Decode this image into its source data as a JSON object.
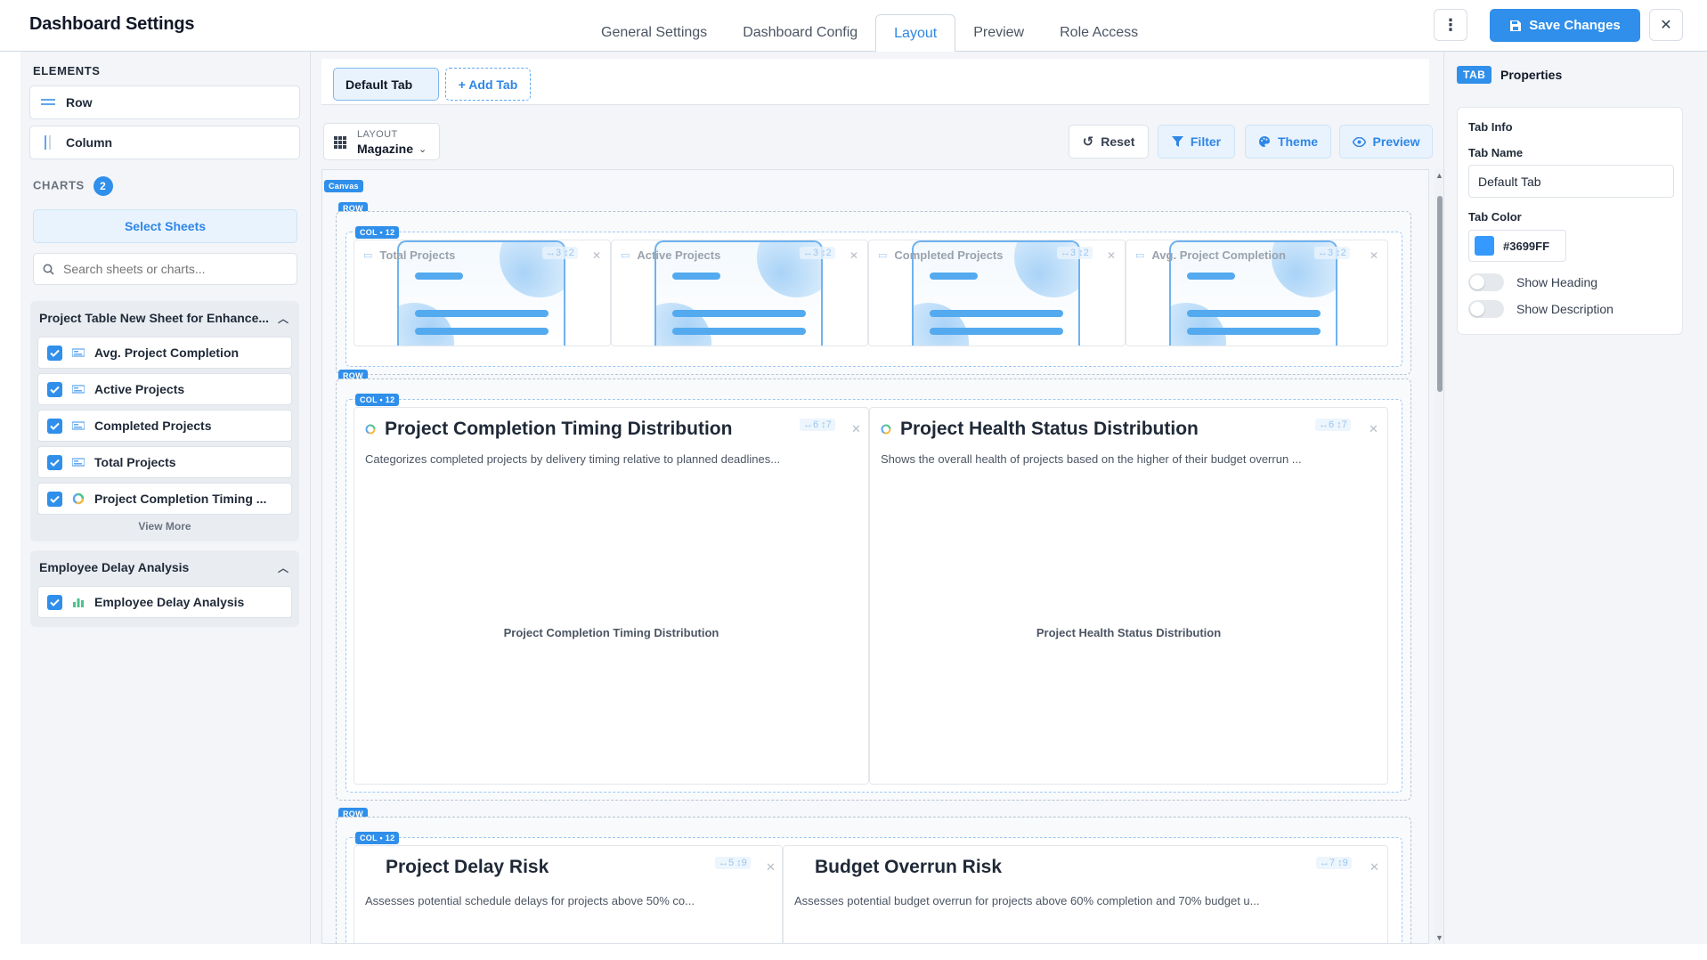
{
  "header": {
    "title": "Dashboard Settings",
    "tabs": [
      {
        "label": "General Settings"
      },
      {
        "label": "Dashboard Config"
      },
      {
        "label": "Layout"
      },
      {
        "label": "Preview"
      },
      {
        "label": "Role Access"
      }
    ],
    "active_tab": "Layout",
    "save_label": "Save Changes",
    "accent_color": "#2F8FEA"
  },
  "sidebar": {
    "elements_title": "ELEMENTS",
    "elements": [
      {
        "label": "Row",
        "icon": "row-icon"
      },
      {
        "label": "Column",
        "icon": "column-icon"
      }
    ],
    "charts_title": "CHARTS",
    "charts_count": "2",
    "select_sheets_label": "Select Sheets",
    "search_placeholder": "Search sheets or charts...",
    "groups": [
      {
        "title": "Project Table New Sheet for Enhance...",
        "items": [
          {
            "label": "Avg. Project Completion",
            "icon": "kpi-icon",
            "checked": true
          },
          {
            "label": "Active Projects",
            "icon": "kpi-icon",
            "checked": true
          },
          {
            "label": "Completed Projects",
            "icon": "kpi-icon",
            "checked": true
          },
          {
            "label": "Total Projects",
            "icon": "kpi-icon",
            "checked": true
          },
          {
            "label": "Project Completion Timing ...",
            "icon": "donut-icon",
            "checked": true
          }
        ],
        "view_more": "View More"
      },
      {
        "title": "Employee Delay Analysis",
        "items": [
          {
            "label": "Employee Delay Analysis",
            "icon": "bar-chart-icon",
            "checked": true
          }
        ]
      }
    ]
  },
  "center": {
    "tab_default": "Default Tab",
    "tab_add": "+ Add Tab",
    "layout_label": "LAYOUT",
    "layout_value": "Magazine",
    "toolbar": {
      "reset": "Reset",
      "filter": "Filter",
      "theme": "Theme",
      "preview": "Preview"
    },
    "canvas_tag": "Canvas",
    "row_tag": "ROW",
    "col_tag": "COL • 12",
    "kpis": [
      {
        "title": "Total Projects",
        "size": "↔3 ↕2"
      },
      {
        "title": "Active Projects",
        "size": "↔3 ↕2"
      },
      {
        "title": "Completed Projects",
        "size": "↔3 ↕2"
      },
      {
        "title": "Avg. Project Completion",
        "size": "↔3 ↕2"
      }
    ],
    "charts_row2": [
      {
        "title": "Project Completion Timing Distribution",
        "desc": "Categorizes completed projects by delivery timing relative to planned deadlines...",
        "placeholder": "Project Completion Timing Distribution",
        "size": "↔6 ↕7"
      },
      {
        "title": "Project Health Status Distribution",
        "desc": "Shows the overall health of projects based on the higher of their budget overrun ...",
        "placeholder": "Project Health Status Distribution",
        "size": "↔6 ↕7"
      }
    ],
    "charts_row3": [
      {
        "title": "Project Delay Risk",
        "desc": "Assesses potential schedule delays for projects above 50% co...",
        "size": "↔5 ↕9"
      },
      {
        "title": "Budget Overrun Risk",
        "desc": "Assesses potential budget overrun for projects above 60% completion and 70% budget u...",
        "size": "↔7 ↕9"
      }
    ]
  },
  "properties": {
    "badge": "TAB",
    "title": "Properties",
    "section": "Tab Info",
    "name_label": "Tab Name",
    "name_value": "Default Tab",
    "color_label": "Tab Color",
    "color_value": "#3699FF",
    "show_heading": "Show Heading",
    "show_heading_on": false,
    "show_description": "Show Description",
    "show_description_on": false
  }
}
